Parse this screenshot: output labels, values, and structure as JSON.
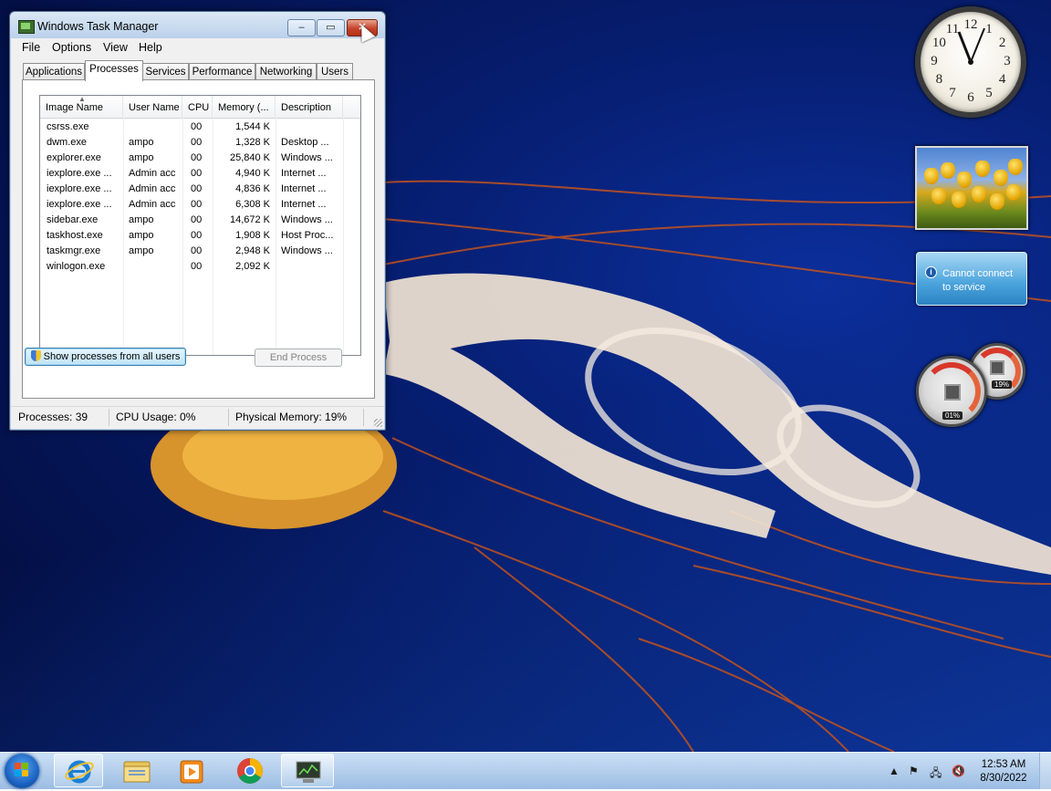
{
  "window": {
    "title": "Windows Task Manager",
    "caption_buttons": {
      "minimize": "–",
      "maximize": "▭",
      "close": "✕"
    },
    "menu": [
      "File",
      "Options",
      "View",
      "Help"
    ],
    "tabs": [
      "Applications",
      "Processes",
      "Services",
      "Performance",
      "Networking",
      "Users"
    ],
    "active_tab": "Processes",
    "columns": [
      "Image Name",
      "User Name",
      "CPU",
      "Memory (...",
      "Description"
    ],
    "rows": [
      {
        "image": "csrss.exe",
        "user": "",
        "cpu": "00",
        "memory": "1,544 K",
        "description": ""
      },
      {
        "image": "dwm.exe",
        "user": "ampo",
        "cpu": "00",
        "memory": "1,328 K",
        "description": "Desktop ..."
      },
      {
        "image": "explorer.exe",
        "user": "ampo",
        "cpu": "00",
        "memory": "25,840 K",
        "description": "Windows ..."
      },
      {
        "image": "iexplore.exe ...",
        "user": "Admin acc",
        "cpu": "00",
        "memory": "4,940 K",
        "description": "Internet ..."
      },
      {
        "image": "iexplore.exe ...",
        "user": "Admin acc",
        "cpu": "00",
        "memory": "4,836 K",
        "description": "Internet ..."
      },
      {
        "image": "iexplore.exe ...",
        "user": "Admin acc",
        "cpu": "00",
        "memory": "6,308 K",
        "description": "Internet ..."
      },
      {
        "image": "sidebar.exe",
        "user": "ampo",
        "cpu": "00",
        "memory": "14,672 K",
        "description": "Windows ..."
      },
      {
        "image": "taskhost.exe",
        "user": "ampo",
        "cpu": "00",
        "memory": "1,908 K",
        "description": "Host Proc..."
      },
      {
        "image": "taskmgr.exe",
        "user": "ampo",
        "cpu": "00",
        "memory": "2,948 K",
        "description": "Windows ..."
      },
      {
        "image": "winlogon.exe",
        "user": "",
        "cpu": "00",
        "memory": "2,092 K",
        "description": ""
      }
    ],
    "buttons": {
      "show_all": "Show processes from all users",
      "end_process": "End Process"
    },
    "status": {
      "processes": "Processes: 39",
      "cpu": "CPU Usage: 0%",
      "memory": "Physical Memory: 19%"
    }
  },
  "gadgets": {
    "clock_numbers": [
      "12",
      "1",
      "2",
      "3",
      "4",
      "5",
      "6",
      "7",
      "8",
      "9",
      "10",
      "11"
    ],
    "weather_text": "Cannot connect to service",
    "cpu_meter": {
      "cpu_label": "01%",
      "memory_label": "19%",
      "cpu_level": 0.01,
      "memory_level": 0.19
    }
  },
  "taskbar": {
    "time": "12:53 AM",
    "date": "8/30/2022",
    "pinned_icons": [
      "internet-explorer-icon",
      "folder-icon",
      "media-player-icon",
      "chrome-icon",
      "task-manager-icon"
    ]
  },
  "colors": {
    "desktop": "#061d6e",
    "close_button": "#c6412a",
    "taskbar": "#b4cdea"
  }
}
